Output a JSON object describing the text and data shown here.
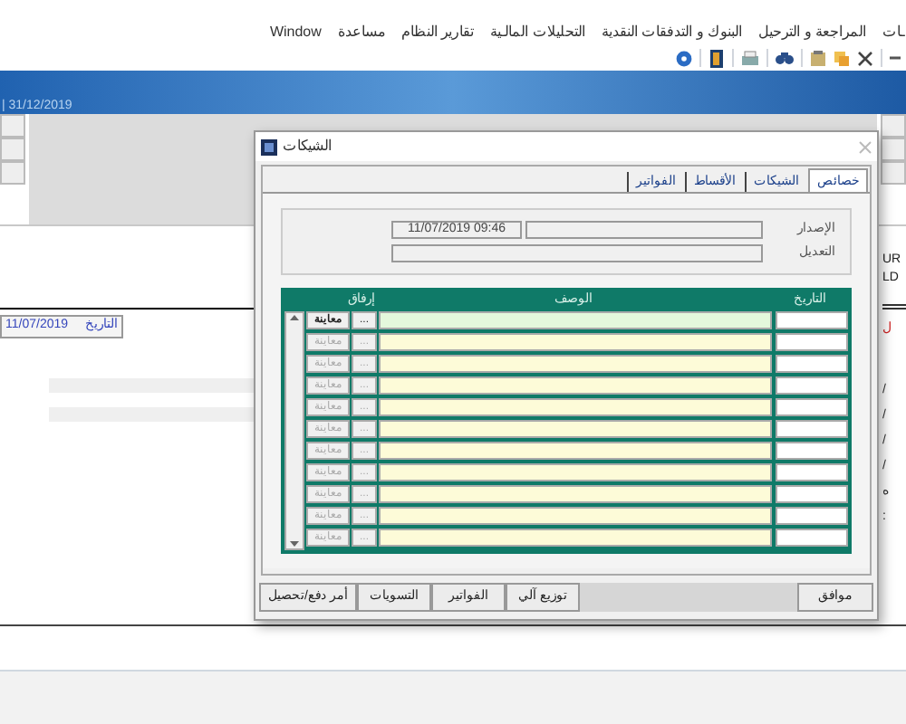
{
  "menu": [
    "ـات",
    "المراجعة و الترحيل",
    "البنوك و التدفقات النقدية",
    "التحليلات المالـية",
    "تقارير النظام",
    "مساعدة",
    "Window"
  ],
  "banner": {
    "period": "| 31/12/2019"
  },
  "main": {
    "date_label": "التاريخ",
    "date_value": "11/07/2019",
    "right_texts": [
      "UR",
      "LD"
    ],
    "right_red": "ل",
    "right_marks": [
      "/",
      "/",
      "/",
      "/",
      "ه",
      ":"
    ]
  },
  "dialog": {
    "title": "الشيكات",
    "tabs": [
      {
        "label": "خصائص",
        "selected": true
      },
      {
        "label": "الشيكات",
        "selected": false
      },
      {
        "label": "الأقساط",
        "selected": false
      },
      {
        "label": "الفواتير",
        "selected": false
      }
    ],
    "issue_label": "الإصدار",
    "issue_date": "11/07/2019 09:46",
    "edit_label": "التعديل",
    "columns": {
      "date": "التاريخ",
      "description": "الوصف",
      "attachment": "إرفاق"
    },
    "rows": [
      {
        "preview": "معاينة",
        "browse": "...",
        "enabled": true,
        "selected": true
      },
      {
        "preview": "معاينة",
        "browse": "...",
        "enabled": false,
        "selected": false
      },
      {
        "preview": "معاينة",
        "browse": "...",
        "enabled": false,
        "selected": false
      },
      {
        "preview": "معاينة",
        "browse": "...",
        "enabled": false,
        "selected": false
      },
      {
        "preview": "معاينة",
        "browse": "...",
        "enabled": false,
        "selected": false
      },
      {
        "preview": "معاينة",
        "browse": "...",
        "enabled": false,
        "selected": false
      },
      {
        "preview": "معاينة",
        "browse": "...",
        "enabled": false,
        "selected": false
      },
      {
        "preview": "معاينة",
        "browse": "...",
        "enabled": false,
        "selected": false
      },
      {
        "preview": "معاينة",
        "browse": "...",
        "enabled": false,
        "selected": false
      },
      {
        "preview": "معاينة",
        "browse": "...",
        "enabled": false,
        "selected": false
      },
      {
        "preview": "معاينة",
        "browse": "...",
        "enabled": false,
        "selected": false
      }
    ],
    "ok_button": "موافق",
    "buttons": [
      "توزيع آلي",
      "الفواتير",
      "التسويات",
      "أمر دفع/تحصيل"
    ]
  }
}
